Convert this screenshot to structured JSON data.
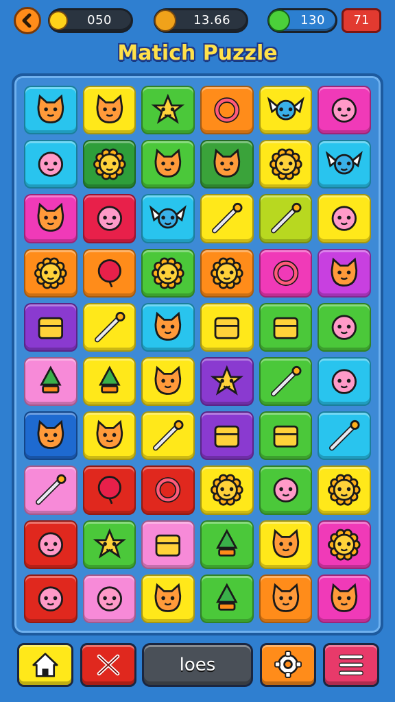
{
  "hud": {
    "coins_value": "050",
    "timer_value": "13.66",
    "gems_value": "130",
    "moves_value": "71"
  },
  "title": "Matich Puzzle",
  "colors": {
    "background": "#2f7fd0",
    "board": "#3d8ad6",
    "title": "#ffe14a",
    "moves_badge": "#e23a30"
  },
  "grid": {
    "rows": 10,
    "cols": 6,
    "tiles": [
      {
        "row": 0,
        "col": 0,
        "color": "#29c4ee",
        "icon": "cat-face-icon"
      },
      {
        "row": 0,
        "col": 1,
        "color": "#ffe81a",
        "icon": "cat-face-icon"
      },
      {
        "row": 0,
        "col": 2,
        "color": "#4bc83a",
        "icon": "star-face-icon"
      },
      {
        "row": 0,
        "col": 3,
        "color": "#ff8c1a",
        "icon": "swirl-icon"
      },
      {
        "row": 0,
        "col": 4,
        "color": "#ffe81a",
        "icon": "winged-creature-icon"
      },
      {
        "row": 0,
        "col": 5,
        "color": "#f03ab8",
        "icon": "hooded-face-icon"
      },
      {
        "row": 1,
        "col": 0,
        "color": "#29c4ee",
        "icon": "bubble-face-icon"
      },
      {
        "row": 1,
        "col": 1,
        "color": "#2e9e3a",
        "icon": "flower-sword-icon"
      },
      {
        "row": 1,
        "col": 2,
        "color": "#4bc83a",
        "icon": "cat-face-icon"
      },
      {
        "row": 1,
        "col": 3,
        "color": "#3aa33a",
        "icon": "cat-face-icon"
      },
      {
        "row": 1,
        "col": 4,
        "color": "#ffe81a",
        "icon": "flower-face-icon"
      },
      {
        "row": 1,
        "col": 5,
        "color": "#29c4ee",
        "icon": "winged-box-icon"
      },
      {
        "row": 2,
        "col": 0,
        "color": "#f03ab8",
        "icon": "winged-cat-icon"
      },
      {
        "row": 2,
        "col": 1,
        "color": "#e8204a",
        "icon": "heart-bubble-icon"
      },
      {
        "row": 2,
        "col": 2,
        "color": "#29c4ee",
        "icon": "winged-ball-icon"
      },
      {
        "row": 2,
        "col": 3,
        "color": "#ffe81a",
        "icon": "crossed-tools-icon"
      },
      {
        "row": 2,
        "col": 4,
        "color": "#b8d820",
        "icon": "gear-sword-icon"
      },
      {
        "row": 2,
        "col": 5,
        "color": "#ffe81a",
        "icon": "bear-face-icon"
      },
      {
        "row": 3,
        "col": 0,
        "color": "#ff8c1a",
        "icon": "sun-face-icon"
      },
      {
        "row": 3,
        "col": 1,
        "color": "#ff8c1a",
        "icon": "drop-face-icon"
      },
      {
        "row": 3,
        "col": 2,
        "color": "#4bc83a",
        "icon": "sun-face-icon"
      },
      {
        "row": 3,
        "col": 3,
        "color": "#ff8c1a",
        "icon": "flower-face-icon"
      },
      {
        "row": 3,
        "col": 4,
        "color": "#f03ab8",
        "icon": "ring-icon"
      },
      {
        "row": 3,
        "col": 5,
        "color": "#c840e0",
        "icon": "cat-face-icon"
      },
      {
        "row": 4,
        "col": 0,
        "color": "#8a3ad0",
        "icon": "easel-icon"
      },
      {
        "row": 4,
        "col": 1,
        "color": "#ffe81a",
        "icon": "pillow-sword-icon"
      },
      {
        "row": 4,
        "col": 2,
        "color": "#29c4ee",
        "icon": "cat-face-icon"
      },
      {
        "row": 4,
        "col": 3,
        "color": "#ffe81a",
        "icon": "gift-box-icon"
      },
      {
        "row": 4,
        "col": 4,
        "color": "#4bc83a",
        "icon": "book-icon"
      },
      {
        "row": 4,
        "col": 5,
        "color": "#4bc83a",
        "icon": "alien-face-icon"
      },
      {
        "row": 5,
        "col": 0,
        "color": "#f78ad8",
        "icon": "trophy-icon"
      },
      {
        "row": 5,
        "col": 1,
        "color": "#ffe81a",
        "icon": "tree-icon"
      },
      {
        "row": 5,
        "col": 2,
        "color": "#ffe81a",
        "icon": "cat-face-icon"
      },
      {
        "row": 5,
        "col": 3,
        "color": "#8a3ad0",
        "icon": "star-wand-icon"
      },
      {
        "row": 5,
        "col": 4,
        "color": "#4bc83a",
        "icon": "screw-icon"
      },
      {
        "row": 5,
        "col": 5,
        "color": "#29c4ee",
        "icon": "bird-face-icon"
      },
      {
        "row": 6,
        "col": 0,
        "color": "#1e6ad0",
        "icon": "cat-face-icon"
      },
      {
        "row": 6,
        "col": 1,
        "color": "#ffe81a",
        "icon": "cat-trophy-icon"
      },
      {
        "row": 6,
        "col": 2,
        "color": "#ffe81a",
        "icon": "paint-brush-icon"
      },
      {
        "row": 6,
        "col": 3,
        "color": "#8a3ad0",
        "icon": "envelope-icon"
      },
      {
        "row": 6,
        "col": 4,
        "color": "#4bc83a",
        "icon": "bag-icon"
      },
      {
        "row": 6,
        "col": 5,
        "color": "#29c4ee",
        "icon": "wrench-icon"
      },
      {
        "row": 7,
        "col": 0,
        "color": "#f78ad8",
        "icon": "bow-arrow-icon"
      },
      {
        "row": 7,
        "col": 1,
        "color": "#e0281e",
        "icon": "balloon-icon"
      },
      {
        "row": 7,
        "col": 2,
        "color": "#e0281e",
        "icon": "lollipop-icon"
      },
      {
        "row": 7,
        "col": 3,
        "color": "#ffe81a",
        "icon": "sun-face-icon"
      },
      {
        "row": 7,
        "col": 4,
        "color": "#4bc83a",
        "icon": "fish-face-icon"
      },
      {
        "row": 7,
        "col": 5,
        "color": "#ffe81a",
        "icon": "sun-face-icon"
      },
      {
        "row": 8,
        "col": 0,
        "color": "#e0281e",
        "icon": "pig-face-icon"
      },
      {
        "row": 8,
        "col": 1,
        "color": "#4bc83a",
        "icon": "star-face-icon"
      },
      {
        "row": 8,
        "col": 2,
        "color": "#f78ad8",
        "icon": "camera-icon"
      },
      {
        "row": 8,
        "col": 3,
        "color": "#4bc83a",
        "icon": "candy-icon"
      },
      {
        "row": 8,
        "col": 4,
        "color": "#ffe81a",
        "icon": "cat-face-icon"
      },
      {
        "row": 8,
        "col": 5,
        "color": "#f03ab8",
        "icon": "sun-face-icon"
      },
      {
        "row": 9,
        "col": 0,
        "color": "#e0281e",
        "icon": "mouse-face-icon"
      },
      {
        "row": 9,
        "col": 1,
        "color": "#f78ad8",
        "icon": "bubble-face-icon"
      },
      {
        "row": 9,
        "col": 2,
        "color": "#ffe81a",
        "icon": "cat-face-icon"
      },
      {
        "row": 9,
        "col": 3,
        "color": "#4bc83a",
        "icon": "lantern-icon"
      },
      {
        "row": 9,
        "col": 4,
        "color": "#ff8c1a",
        "icon": "cat-face-icon"
      },
      {
        "row": 9,
        "col": 5,
        "color": "#f03ab8",
        "icon": "cat-face-icon"
      }
    ]
  },
  "bottom_bar": {
    "middle_label": "loes",
    "buttons": [
      {
        "icon": "home-icon",
        "color": "#ffe81a"
      },
      {
        "icon": "shuffle-icon",
        "color": "#e0281e"
      },
      {
        "icon": "gear-icon",
        "color": "#ff8c1a"
      },
      {
        "icon": "menu-icon",
        "color": "#e83a6a"
      }
    ]
  }
}
